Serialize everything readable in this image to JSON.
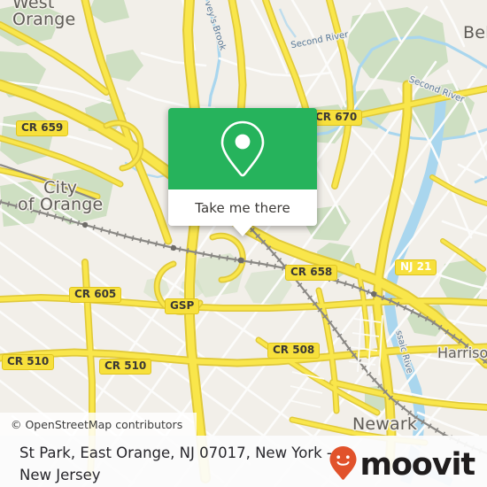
{
  "map": {
    "attribution": "© OpenStreetMap contributors",
    "colors": {
      "land": "#F2EFE9",
      "road_yellow": "#F7E03C",
      "road_casing": "#E3CB35",
      "minor_road": "#FFFFFF",
      "park_green": "#CCDFC1",
      "water_blue": "#A9D6EE",
      "rail": "#7A7874",
      "shield_fill": "#F7E03C",
      "shield_border": "#E0C520",
      "label_text": "#66635E"
    },
    "places": [
      {
        "name": "West Orange",
        "line1": "West",
        "line2": "Orange"
      },
      {
        "name": "City of Orange",
        "line1": "City",
        "line2": "of Orange"
      },
      {
        "name": "Belleville",
        "line1": "Bell"
      },
      {
        "name": "Newark",
        "line1": "Newark"
      },
      {
        "name": "Harrison",
        "line1": "Harrison"
      }
    ],
    "waterways": [
      {
        "label": "Second River"
      },
      {
        "label": "Second River"
      },
      {
        "label": "vey's Brook"
      },
      {
        "label": "Passaic River",
        "short": "ssaic Rive"
      }
    ],
    "shields": [
      {
        "label": "CR 659",
        "style": "dark"
      },
      {
        "label": "CR 670",
        "style": "dark"
      },
      {
        "label": "CR 658",
        "style": "dark"
      },
      {
        "label": "NJ 21",
        "style": "white"
      },
      {
        "label": "CR 605",
        "style": "dark"
      },
      {
        "label": "GSP",
        "style": "dark"
      },
      {
        "label": "CR 508",
        "style": "dark"
      },
      {
        "label": "CR 510",
        "style": "dark"
      },
      {
        "label": "CR 510",
        "style": "dark"
      }
    ]
  },
  "popup": {
    "action_label": "Take me there",
    "icon": "map-pin-icon",
    "header_color": "#26B35C"
  },
  "caption": {
    "title": "St Park, East Orange, NJ 07017, New York - New Jersey"
  },
  "brand": {
    "name": "moovit",
    "logo_icon": "moovit-pin-smile-icon",
    "logo_color": "#E1522B"
  }
}
